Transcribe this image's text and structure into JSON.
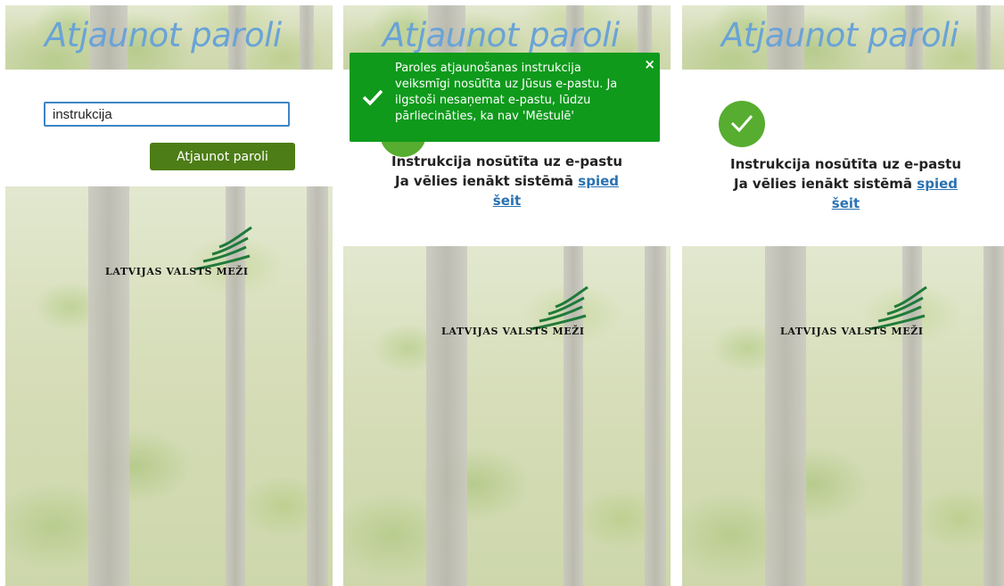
{
  "panels": {
    "reset_form": {
      "title": "Atjaunot paroli",
      "email_input_value": "instrukcija",
      "submit_label": "Atjaunot paroli",
      "logo_text": "LATVIJAS VALSTS MEŽI"
    },
    "with_notification": {
      "title": "Atjaunot paroli",
      "toast": {
        "message": "Paroles atjaunošanas instrukcija\nveiksmīgi nosūtīta uz Jūsus e-pastu. Ja\nilgstoši nesaņemat e-pastu, lūdzu\npārliecināties, ka nav 'Mēstulē'",
        "close": "×"
      },
      "success_line": "Instrukcija nosūtīta uz e-pastu",
      "login_prefix": "Ja vēlies ienākt sistēmā ",
      "login_link_1": "spied",
      "login_link_2": "šeit",
      "logo_text": "LATVIJAS VALSTS MEŽI"
    },
    "after_dismiss": {
      "title": "Atjaunot paroli",
      "success_line": "Instrukcija nosūtīta uz e-pastu",
      "login_prefix": "Ja vēlies ienākt sistēmā ",
      "login_link_1": "spied",
      "login_link_2": "šeit",
      "logo_text": "LATVIJAS VALSTS MEŽI"
    }
  },
  "colors": {
    "title": "#6aa3d6",
    "button": "#4d7d16",
    "toast": "#0f9a1c",
    "check": "#56ad2f",
    "link": "#2a72b2",
    "logo_mark": "#1f7a3a"
  },
  "icons": [
    "check-icon",
    "close-icon",
    "logo-tree-icon"
  ]
}
